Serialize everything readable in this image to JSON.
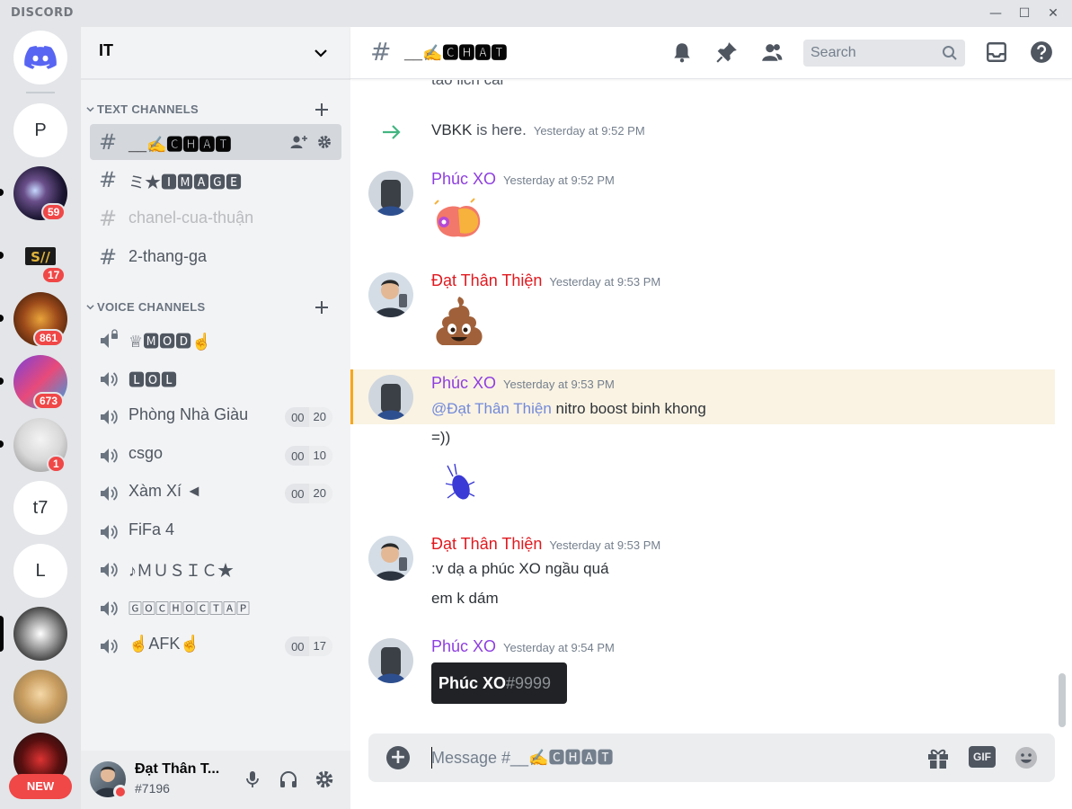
{
  "window": {
    "brand": "DISCORD",
    "minimize": "—",
    "maximize": "☐",
    "close": "✕"
  },
  "guilds": {
    "letters": [
      "P",
      "t7",
      "L"
    ],
    "badges": [
      "59",
      "17",
      "861",
      "673",
      "1"
    ],
    "new_label": "NEW"
  },
  "server": {
    "name": "IT"
  },
  "categories": {
    "text": "TEXT CHANNELS",
    "voice": "VOICE CHANNELS"
  },
  "text_channels": [
    {
      "name": "__✍️🅲🅷🅰🆃"
    },
    {
      "name": "ミ★🅸🅼🅰🅶🅴"
    },
    {
      "name": "chanel-cua-thuận"
    },
    {
      "name": "2-thang-ga"
    }
  ],
  "voice_channels": [
    {
      "name": "♕🅼🅾🅳☝️"
    },
    {
      "name": "🅻🅾🅻"
    },
    {
      "name": "Phòng Nhà Giàu",
      "used": "00",
      "limit": "20"
    },
    {
      "name": "csgo",
      "used": "00",
      "limit": "10"
    },
    {
      "name": "Xàm Xí ◄",
      "used": "00",
      "limit": "20"
    },
    {
      "name": "FiFa 4"
    },
    {
      "name": "♪ＭＵＳＩＣ★"
    },
    {
      "name": "🄶🄾🄲🄷🄾🄲🅃🄰🄿"
    },
    {
      "name": "☝️AFK☝️",
      "used": "00",
      "limit": "17"
    }
  ],
  "user": {
    "name": "Đạt Thân T...",
    "tag": "#7196"
  },
  "chat": {
    "channel": "__✍️🅲🅷🅰🆃",
    "search_placeholder": "Search",
    "composer_placeholder": "Message #__✍️🅲🅷🅰🆃",
    "gif_label": "GIF"
  },
  "messages": {
    "cut_top": "tao lich cai",
    "join": {
      "user": "VBKK",
      "rest": " is here.",
      "time": "Yesterday at 9:52 PM"
    },
    "m1": {
      "author": "Phúc XO",
      "time": "Yesterday at 9:52 PM"
    },
    "m2": {
      "author": "Đạt Thân Thiện",
      "time": "Yesterday at 9:53 PM"
    },
    "m3": {
      "author": "Phúc XO",
      "time": "Yesterday at 9:53 PM",
      "mention": "@Đạt Thân Thiện",
      "text": " nitro boost binh khong",
      "text2": "=))"
    },
    "m4": {
      "author": "Đạt Thân Thiện",
      "time": "Yesterday at 9:53 PM",
      "text": ":v dạ a phúc XO ngầu quá",
      "text2": "em k dám"
    },
    "m5": {
      "author": "Phúc XO",
      "time": "Yesterday at 9:54 PM",
      "card_name": "Phúc XO",
      "card_disc": "#9999"
    }
  },
  "colors": {
    "author_purple": "#8e3ee0",
    "author_red": "#e0191f",
    "join_arrow": "#43b581",
    "mention": "#7289da"
  },
  "icons": [
    "discord-logo-icon",
    "chevron-down-icon",
    "plus-icon",
    "hash-icon",
    "speaker-icon",
    "bell-icon",
    "pin-icon",
    "members-icon",
    "search-icon",
    "inbox-icon",
    "help-icon",
    "mic-icon",
    "headphones-icon",
    "gear-icon",
    "add-member-icon",
    "gift-icon",
    "emoji-icon",
    "join-arrow-icon"
  ]
}
